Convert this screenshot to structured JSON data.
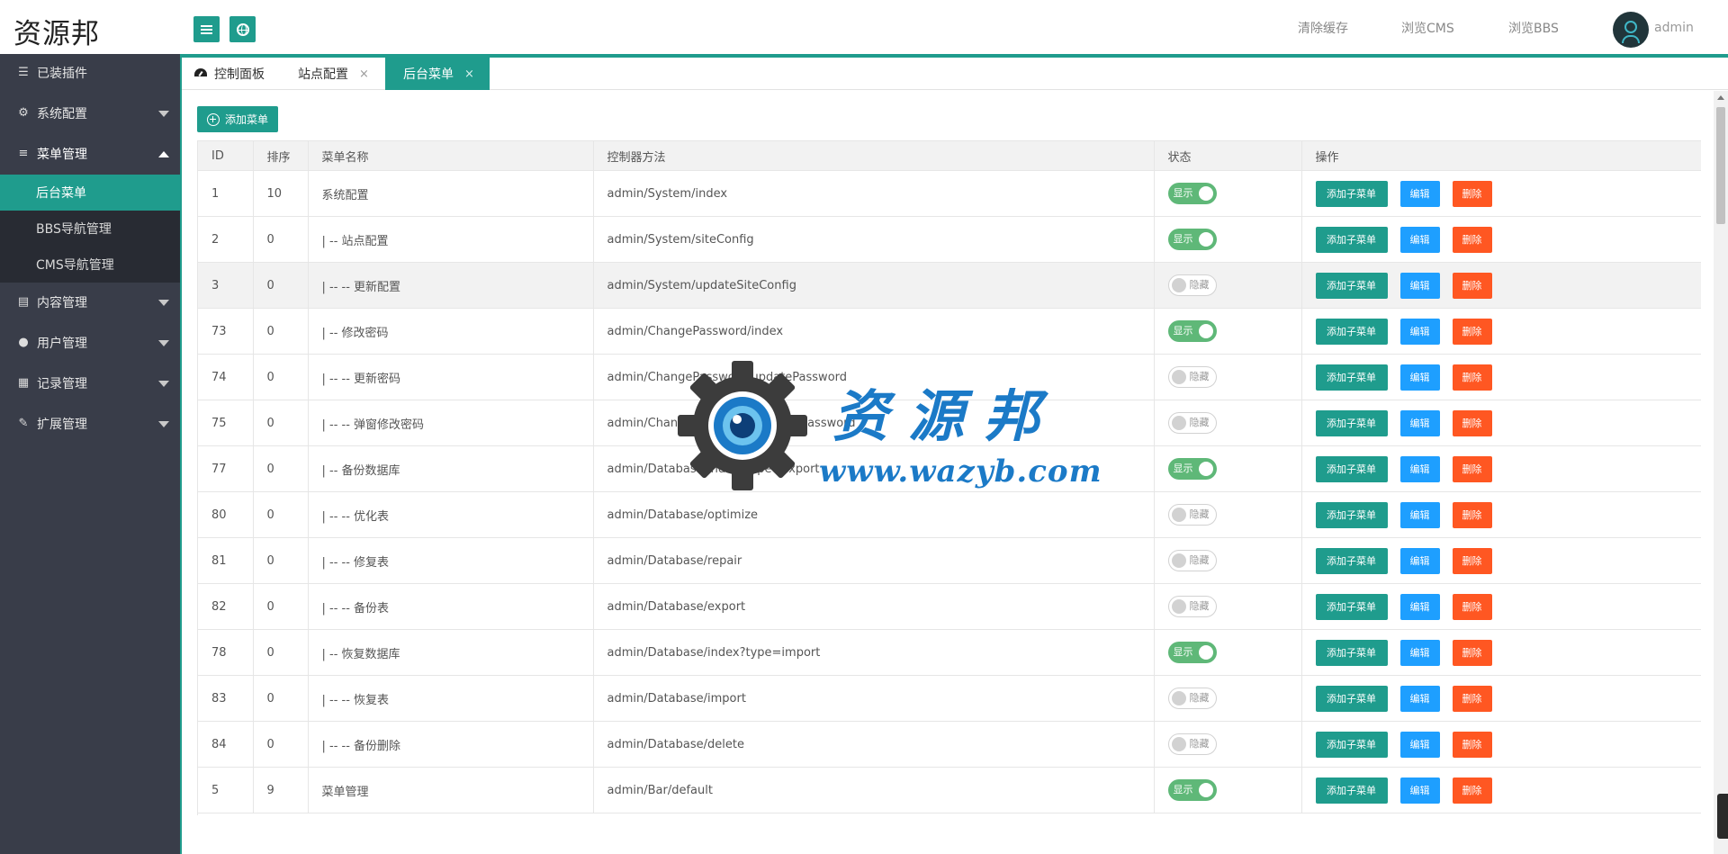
{
  "header": {
    "logo": "资源邦",
    "menu_toggle_icon": "menu-icon",
    "globe_icon": "globe-icon",
    "links": [
      "清除缓存",
      "浏览CMS",
      "浏览BBS"
    ],
    "user": "admin"
  },
  "sidebar": {
    "items": [
      {
        "label": "已装插件",
        "icon": "sliders-icon",
        "caret": false
      },
      {
        "label": "系统配置",
        "icon": "gears-icon",
        "caret": true
      },
      {
        "label": "菜单管理",
        "icon": "list-icon",
        "caret": true,
        "open": true
      },
      {
        "label": "内容管理",
        "icon": "file-icon",
        "caret": true
      },
      {
        "label": "用户管理",
        "icon": "users-icon",
        "caret": true
      },
      {
        "label": "记录管理",
        "icon": "grid-icon",
        "caret": true
      },
      {
        "label": "扩展管理",
        "icon": "wrench-icon",
        "caret": true
      }
    ],
    "sub_items": [
      {
        "label": "后台菜单",
        "active": true
      },
      {
        "label": "BBS导航管理",
        "active": false
      },
      {
        "label": "CMS导航管理",
        "active": false
      }
    ]
  },
  "tabs": [
    {
      "label": "控制面板",
      "closable": false,
      "active": false
    },
    {
      "label": "站点配置",
      "closable": true,
      "active": false
    },
    {
      "label": "后台菜单",
      "closable": true,
      "active": true
    }
  ],
  "tab_close_glyph": "×",
  "toolbar": {
    "add_menu_label": "添加菜单"
  },
  "table": {
    "headers": [
      "ID",
      "排序",
      "菜单名称",
      "控制器方法",
      "状态",
      "操作"
    ],
    "status_on": "显示",
    "status_off": "隐藏",
    "op_add_child": "添加子菜单",
    "op_edit": "编辑",
    "op_delete": "删除",
    "rows": [
      {
        "id": "1",
        "sort": "10",
        "name": "系统配置",
        "method": "admin/System/index",
        "show": true
      },
      {
        "id": "2",
        "sort": "0",
        "name": "| -- 站点配置",
        "method": "admin/System/siteConfig",
        "show": true
      },
      {
        "id": "3",
        "sort": "0",
        "name": "| -- -- 更新配置",
        "method": "admin/System/updateSiteConfig",
        "show": false,
        "highlight": true
      },
      {
        "id": "73",
        "sort": "0",
        "name": "| -- 修改密码",
        "method": "admin/ChangePassword/index",
        "show": true
      },
      {
        "id": "74",
        "sort": "0",
        "name": "| -- -- 更新密码",
        "method": "admin/ChangePassword/updatePassword",
        "show": false
      },
      {
        "id": "75",
        "sort": "0",
        "name": "| -- -- 弹窗修改密码",
        "method": "admin/ChangePassword/change_password",
        "show": false
      },
      {
        "id": "77",
        "sort": "0",
        "name": "| -- 备份数据库",
        "method": "admin/Database/index?type=export",
        "show": true
      },
      {
        "id": "80",
        "sort": "0",
        "name": "| -- -- 优化表",
        "method": "admin/Database/optimize",
        "show": false
      },
      {
        "id": "81",
        "sort": "0",
        "name": "| -- -- 修复表",
        "method": "admin/Database/repair",
        "show": false
      },
      {
        "id": "82",
        "sort": "0",
        "name": "| -- -- 备份表",
        "method": "admin/Database/export",
        "show": false
      },
      {
        "id": "78",
        "sort": "0",
        "name": "| -- 恢复数据库",
        "method": "admin/Database/index?type=import",
        "show": true
      },
      {
        "id": "83",
        "sort": "0",
        "name": "| -- -- 恢复表",
        "method": "admin/Database/import",
        "show": false
      },
      {
        "id": "84",
        "sort": "0",
        "name": "| -- -- 备份删除",
        "method": "admin/Database/delete",
        "show": false
      },
      {
        "id": "5",
        "sort": "9",
        "name": "菜单管理",
        "method": "admin/Bar/default",
        "show": true
      }
    ]
  },
  "watermark": {
    "text_cn": "资源邦",
    "url": "www.wazyb.com"
  },
  "colors": {
    "accent": "#1f9c8d",
    "sidebar": "#393d49",
    "switch_on": "#5fb878",
    "edit": "#1e9fff",
    "delete": "#ff5722"
  }
}
